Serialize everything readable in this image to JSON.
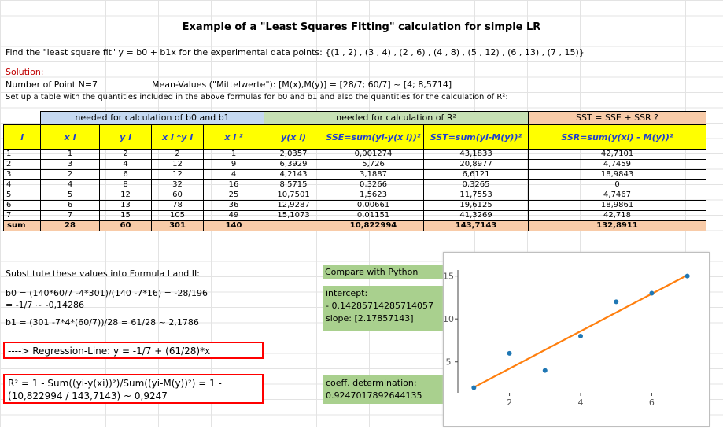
{
  "title": "Example of a \"Least Squares Fitting\" calculation for simple LR",
  "problem": "Find the \"least square fit\" y = b0 + b1x  for the experimental data points:  {(1 , 2) , (3 , 4) , (2 , 6) , (4 , 8) , (5 , 12) , (6 , 13) , (7 , 15)}",
  "solution_label": "Solution:",
  "num_points": "Number of Point N=7",
  "mean_values": "Mean-Values (\"Mittelwerte\"): [M(x),M(y)] = [28/7; 60/7] ~ [4; 8,5714]",
  "setup_text": "Set up a table with the quantities included in the above formulas for b0 and b1  and also the quantities for the calculation of R²:",
  "group_headers": {
    "b": "needed for calculation of b0 and b1",
    "r": "needed for calculation of R²",
    "sst": "SST =  SSE + SSR ?"
  },
  "columns": [
    "i",
    "x i",
    "y i",
    "x i *y i",
    "x i ²",
    "y(x i)",
    "SSE=sum(yi-y(x i))²",
    "SST=sum(yi-M(y))²",
    "SSR=sum(y(xi) - M(y))²"
  ],
  "rows": [
    [
      "1",
      "1",
      "2",
      "2",
      "1",
      "2,0357",
      "0,001274",
      "43,1833",
      "42,7101"
    ],
    [
      "2",
      "3",
      "4",
      "12",
      "9",
      "6,3929",
      "5,726",
      "20,8977",
      "4,7459"
    ],
    [
      "3",
      "2",
      "6",
      "12",
      "4",
      "4,2143",
      "3,1887",
      "6,6121",
      "18,9843"
    ],
    [
      "4",
      "4",
      "8",
      "32",
      "16",
      "8,5715",
      "0,3266",
      "0,3265",
      "0"
    ],
    [
      "5",
      "5",
      "12",
      "60",
      "25",
      "10,7501",
      "1,5623",
      "11,7553",
      "4,7467"
    ],
    [
      "6",
      "6",
      "13",
      "78",
      "36",
      "12,9287",
      "0,00661",
      "19,6125",
      "18,9861"
    ],
    [
      "7",
      "7",
      "15",
      "105",
      "49",
      "15,1073",
      "0,01151",
      "41,3269",
      "42,718"
    ]
  ],
  "sum_row": [
    "sum",
    "28",
    "60",
    "301",
    "140",
    "",
    "10,822994",
    "143,7143",
    "132,8911"
  ],
  "substitute": "Substitute these values into Formula I and II:",
  "b0_line1": "b0 = (140*60/7 -4*301)/(140 -7*16) = -28/196",
  "b0_line2": "= -1/7  ~ -0,14286",
  "b1_line": "b1  = (301 -7*4*(60/7))/28  = 61/28 ~ 2,1786",
  "regression": "----> Regression-Line:  y =  -1/7 + (61/28)*x",
  "r2_line1": "R² = 1 - Sum((yi-y(xi))²)/Sum((yi-M(y))²) = 1 -",
  "r2_line2": "(10,822994 / 143,7143) ~ 0,9247",
  "python": {
    "compare": "Compare with Python",
    "intercept_label": "intercept:",
    "intercept_value": " - 0.14285714285714057",
    "slope": "slope: [2.17857143]",
    "coeff_label": "coeff.  determination:",
    "coeff_value": "0.9247017892644135"
  },
  "chart_data": {
    "type": "scatter",
    "x": [
      1,
      3,
      2,
      4,
      5,
      6,
      7
    ],
    "y": [
      2,
      4,
      6,
      8,
      12,
      13,
      15
    ],
    "fit_line": {
      "x": [
        1,
        7
      ],
      "y": [
        2.0357,
        15.1073
      ]
    },
    "xticks": [
      2,
      4,
      6
    ],
    "yticks": [
      5,
      10,
      15
    ],
    "xlim": [
      0.55,
      7.45
    ],
    "ylim": [
      1.4,
      15.7
    ],
    "grid": false,
    "point_color": "#1f77b4",
    "line_color": "#ff7f0e"
  }
}
